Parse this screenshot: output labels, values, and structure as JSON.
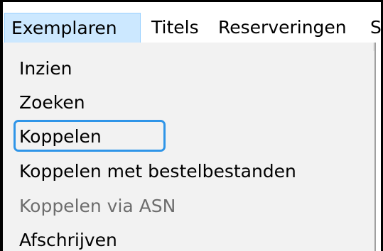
{
  "menubar": {
    "items": [
      {
        "label": "Exemplaren",
        "active": true
      },
      {
        "label": "Titels",
        "active": false
      },
      {
        "label": "Reserveringen",
        "active": false
      },
      {
        "label": "St",
        "active": false
      }
    ]
  },
  "dropdown": {
    "items": [
      {
        "label": "Inzien",
        "enabled": true
      },
      {
        "label": "Zoeken",
        "enabled": true
      },
      {
        "label": "Koppelen",
        "enabled": true,
        "highlighted": true
      },
      {
        "label": "Koppelen met bestelbestanden",
        "enabled": true
      },
      {
        "label": "Koppelen via ASN",
        "enabled": false
      },
      {
        "label": "Afschrijven",
        "enabled": true
      }
    ]
  },
  "colors": {
    "active_menu_bg": "#cce8ff",
    "focus_ring": "#2f95e8",
    "dropdown_bg": "#f2f2f2",
    "disabled_text": "#6d6d6d"
  }
}
